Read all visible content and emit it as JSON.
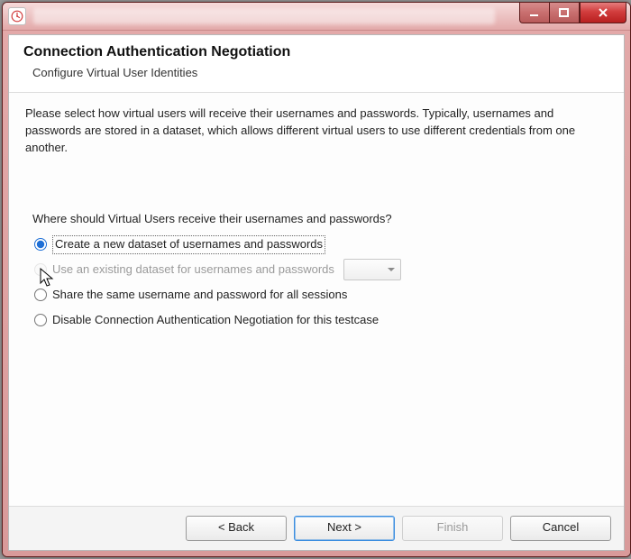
{
  "window": {
    "title": ""
  },
  "header": {
    "title": "Connection Authentication Negotiation",
    "subtitle": "Configure Virtual User Identities"
  },
  "body": {
    "intro": "Please select how virtual users will receive their usernames and passwords. Typically, usernames and passwords are stored in a dataset, which allows different virtual users to use different credentials from one another.",
    "question": "Where should Virtual Users receive their usernames and passwords?",
    "options": {
      "create": "Create a new dataset of usernames and passwords",
      "existing": "Use an existing dataset for usernames and passwords",
      "share": "Share the same username and password for all sessions",
      "disable": "Disable Connection Authentication Negotiation for this testcase"
    },
    "selected": "create",
    "existing_enabled": false
  },
  "buttons": {
    "back": "< Back",
    "next": "Next >",
    "finish": "Finish",
    "cancel": "Cancel"
  }
}
